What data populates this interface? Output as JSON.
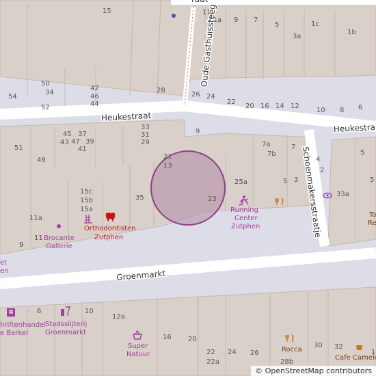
{
  "streets": {
    "heukestraat_left": "Heukestraat",
    "heukestraat_right": "Heukestraat",
    "oude_gasthuissteeg": "Oude Gasthuissteeg",
    "schoenmakersstraatje": "Schoenmakersstraatje",
    "groenmarkt": "Groenmarkt",
    "top_partial": "raat"
  },
  "pois": {
    "running": [
      "Running",
      "Center",
      "Zutphen"
    ],
    "ortho": [
      "Orthodontisten",
      "Zutphen"
    ],
    "brocante": [
      "Brocante",
      "Gallerie"
    ],
    "leftcut": [
      "et",
      "en"
    ],
    "schrift": [
      "hriftenhandel",
      "e Berkel"
    ],
    "stads": [
      "Stadsslijterij",
      "Groenmarkt"
    ],
    "super": [
      "Super",
      "Natuur"
    ],
    "rocca": "Rocca",
    "cafe": "Cafe Camelot",
    "to": [
      "To",
      "Re"
    ]
  },
  "house_numbers": {
    "n15": "15",
    "n11": "11",
    "n11a": "11a",
    "n9": "9",
    "n7": "7",
    "n5top": "5",
    "n3a": "3a",
    "n1c": "1c",
    "n1b": "1b",
    "n54": "54",
    "n50": "50",
    "n34": "34",
    "n52": "52",
    "n42": "42",
    "n46": "46",
    "n44": "44",
    "n28": "28",
    "n26": "26",
    "n24": "24",
    "n22": "22",
    "n20": "20",
    "n16": "16",
    "n14": "14",
    "n12": "12",
    "n10": "10",
    "n8": "8",
    "n6": "6",
    "n33": "33",
    "n31": "31",
    "n29": "29",
    "n9b": "9",
    "n51": "51",
    "n45": "45",
    "n37": "37",
    "n43": "43",
    "n47": "47",
    "n39": "39",
    "n41": "41",
    "n49": "49",
    "n21": "21",
    "n13": "13",
    "n7a": "7a",
    "n7b": "7b",
    "n7r": "7",
    "n5": "5",
    "n5b": "5",
    "n3": "3",
    "n25a": "25a",
    "n23": "23",
    "n35": "35",
    "n15c": "15c",
    "n15b": "15b",
    "n15a": "15a",
    "n11bot": "11a",
    "n11b": "11",
    "n9c": "9",
    "n4": "4",
    "n2": "2",
    "n33a": "33a",
    "n6b": "6",
    "n10b": "10",
    "n12a": "12a",
    "n16b": "16",
    "n20b": "20",
    "n22b": "22",
    "n22a": "22a",
    "n24b": "24",
    "n26b": "26",
    "n28b": "28b",
    "n30": "30",
    "n32": "32",
    "n1": "1"
  },
  "attribution": "© OpenStreetMap contributors",
  "colors": {
    "building": "#d9d0c9",
    "road": "#ffffff",
    "pedestrian": "#dddde8",
    "marker_fill": "#b08aa6",
    "marker_stroke": "#8c3f86",
    "poi_brown": "#7a3d1a",
    "poi_purple": "#a43ca4",
    "poi_red": "#c21616"
  }
}
